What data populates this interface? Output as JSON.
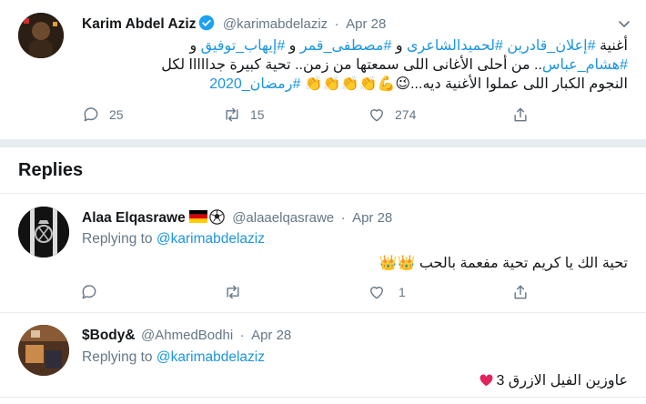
{
  "colors": {
    "link": "#1b95e0",
    "secondary_text": "#657786",
    "divider": "#e6ecf0",
    "verified": "#1da1f2",
    "heart": "#e0245e"
  },
  "main_tweet": {
    "author_name": "Karim Abdel Aziz",
    "handle": "@karimabdelaziz",
    "separator": "·",
    "date": "Apr 28",
    "text_line1_prefix": "أغنية ",
    "hashtag1": "#إعلان_قادرين",
    "hashtag2": "#لحميدالشاعرى",
    "text_and1": " و ",
    "hashtag3": "#مصطفى_قمر",
    "text_and2": " و ",
    "hashtag4": "#إيهاب_توفيق",
    "text_and3": " و",
    "hashtag5": "#هشام_عباس",
    "text_line2": ".. من أحلى الأغانى اللى سمعتها من زمن.. تحية كبيرة جدااااا لكل",
    "text_line3": "النجوم الكبار اللى عملوا الأغنية ديه...😉💪👏👏👏👏 ",
    "hashtag6": "#رمضان_2020",
    "reply_count": "25",
    "retweet_count": "15",
    "like_count": "274"
  },
  "replies_heading": "Replies",
  "replies": [
    {
      "author_name": "Alaa Elqasrawe",
      "handle": "@alaaelqasrawe",
      "separator": "·",
      "date": "Apr 28",
      "replying_prefix": "Replying to ",
      "replying_to": "@karimabdelaziz",
      "text": "تحية الك يا كريم تحية مفعمة بالحب 👑👑",
      "reply_count": "",
      "retweet_count": "",
      "like_count": "1"
    },
    {
      "author_name": "$Body&",
      "handle": "@AhmedBodhi",
      "separator": "·",
      "date": "Apr 28",
      "replying_prefix": "Replying to ",
      "replying_to": "@karimabdelaziz",
      "text": "عاوزين الفيل الازرق 3"
    }
  ]
}
